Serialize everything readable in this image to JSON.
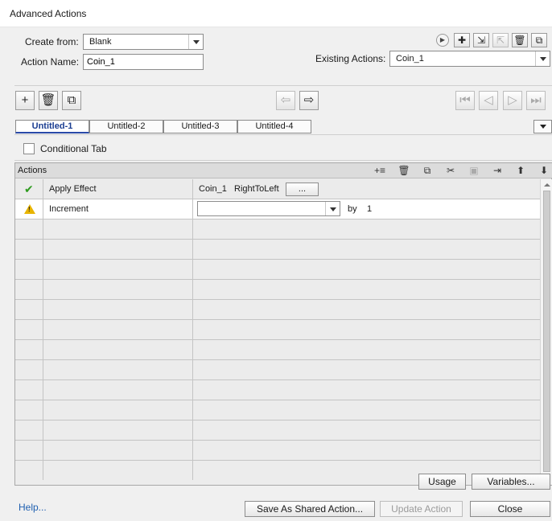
{
  "window": {
    "title": "Advanced Actions"
  },
  "form": {
    "create_from_label": "Create from:",
    "create_from_value": "Blank",
    "action_name_label": "Action Name:",
    "action_name_value": "Coin_1",
    "existing_actions_label": "Existing Actions:",
    "existing_actions_value": "Coin_1"
  },
  "tabs": [
    {
      "label": "Untitled-1",
      "active": true
    },
    {
      "label": "Untitled-2",
      "active": false
    },
    {
      "label": "Untitled-3",
      "active": false
    },
    {
      "label": "Untitled-4",
      "active": false
    }
  ],
  "conditional": {
    "label": "Conditional Tab",
    "checked": false
  },
  "actions_grid": {
    "header": "Actions",
    "rows": [
      {
        "status": "ok",
        "action": "Apply Effect",
        "object": "Coin_1",
        "effect": "RightToLeft",
        "button": "..."
      },
      {
        "status": "warning",
        "action": "Increment",
        "variable_value": "",
        "by_label": "by",
        "by_value": "1"
      }
    ],
    "empty_rows": 12
  },
  "buttons": {
    "usage": "Usage",
    "variables": "Variables...",
    "help": "Help...",
    "save_shared": "Save As Shared Action...",
    "update_action": "Update Action",
    "close": "Close"
  },
  "colors": {
    "accent": "#1a3d91",
    "link": "#2060b0",
    "ok": "#2e9b1f",
    "warning": "#e8b400"
  }
}
